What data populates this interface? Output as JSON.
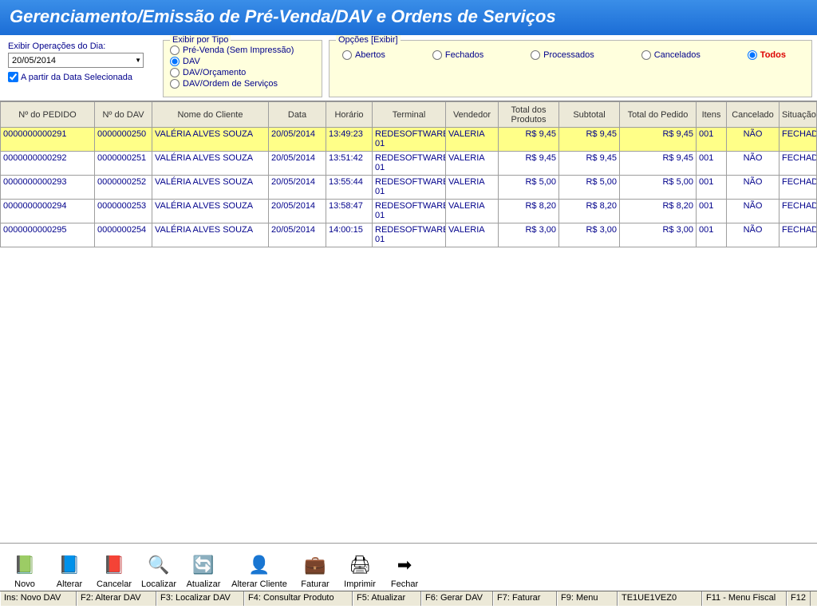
{
  "title": "Gerenciamento/Emissão de Pré-Venda/DAV e Ordens de Serviços",
  "date": {
    "label": "Exibir Operações do Dia:",
    "value": "20/05/2014",
    "fromLabel": "A partir da Data Selecionada",
    "fromChecked": true
  },
  "tipo": {
    "legend": "Exibir por Tipo",
    "opts": [
      "Pré-Venda (Sem Impressão)",
      "DAV",
      "DAV/Orçamento",
      "DAV/Ordem de Serviços"
    ],
    "selected": 1
  },
  "opcoes": {
    "legend": "Opções [Exibir]",
    "opts": [
      "Abertos",
      "Fechados",
      "Processados",
      "Cancelados",
      "Todos"
    ],
    "selected": 4
  },
  "columns": [
    "Nº do PEDIDO",
    "Nº do DAV",
    "Nome do Cliente",
    "Data",
    "Horário",
    "Terminal",
    "Vendedor",
    "Total dos Produtos",
    "Subtotal",
    "Total do Pedido",
    "Itens",
    "Cancelado",
    "Situação"
  ],
  "rows": [
    {
      "pedido": "0000000000291",
      "dav": "0000000250",
      "cliente": "VALÉRIA ALVES SOUZA",
      "data": "20/05/2014",
      "hora": "13:49:23",
      "term": "REDESOFTWARE 01",
      "vend": "VALERIA",
      "tprod": "R$ 9,45",
      "subt": "R$ 9,45",
      "tped": "R$ 9,45",
      "itens": "001",
      "canc": "NÃO",
      "sit": "FECHADO"
    },
    {
      "pedido": "0000000000292",
      "dav": "0000000251",
      "cliente": "VALÉRIA ALVES SOUZA",
      "data": "20/05/2014",
      "hora": "13:51:42",
      "term": "REDESOFTWARE 01",
      "vend": "VALERIA",
      "tprod": "R$ 9,45",
      "subt": "R$ 9,45",
      "tped": "R$ 9,45",
      "itens": "001",
      "canc": "NÃO",
      "sit": "FECHADO"
    },
    {
      "pedido": "0000000000293",
      "dav": "0000000252",
      "cliente": "VALÉRIA ALVES SOUZA",
      "data": "20/05/2014",
      "hora": "13:55:44",
      "term": "REDESOFTWARE 01",
      "vend": "VALERIA",
      "tprod": "R$ 5,00",
      "subt": "R$ 5,00",
      "tped": "R$ 5,00",
      "itens": "001",
      "canc": "NÃO",
      "sit": "FECHADO"
    },
    {
      "pedido": "0000000000294",
      "dav": "0000000253",
      "cliente": "VALÉRIA ALVES SOUZA",
      "data": "20/05/2014",
      "hora": "13:58:47",
      "term": "REDESOFTWARE 01",
      "vend": "VALERIA",
      "tprod": "R$ 8,20",
      "subt": "R$ 8,20",
      "tped": "R$ 8,20",
      "itens": "001",
      "canc": "NÃO",
      "sit": "FECHADO"
    },
    {
      "pedido": "0000000000295",
      "dav": "0000000254",
      "cliente": "VALÉRIA ALVES SOUZA",
      "data": "20/05/2014",
      "hora": "14:00:15",
      "term": "REDESOFTWARE 01",
      "vend": "VALERIA",
      "tprod": "R$ 3,00",
      "subt": "R$ 3,00",
      "tped": "R$ 3,00",
      "itens": "001",
      "canc": "NÃO",
      "sit": "FECHADO"
    }
  ],
  "toolbar": [
    {
      "name": "novo",
      "label": "Novo",
      "icon": "📗",
      "w": 0
    },
    {
      "name": "alterar",
      "label": "Alterar",
      "icon": "📘",
      "w": 0
    },
    {
      "name": "cancelar",
      "label": "Cancelar",
      "icon": "📕",
      "w": 0
    },
    {
      "name": "localizar",
      "label": "Localizar",
      "icon": "🔍",
      "w": 0
    },
    {
      "name": "atualizar",
      "label": "Atualizar",
      "icon": "🔄",
      "w": 0
    },
    {
      "name": "alterar-cliente",
      "label": "Alterar Cliente",
      "icon": "👤",
      "w": 1
    },
    {
      "name": "faturar",
      "label": "Faturar",
      "icon": "💼",
      "w": 0
    },
    {
      "name": "imprimir",
      "label": "Imprimir",
      "icon": "🖨",
      "w": 0
    },
    {
      "name": "fechar",
      "label": "Fechar",
      "icon": "➡",
      "w": 0
    }
  ],
  "status": [
    "Ins: Novo DAV",
    "F2: Alterar DAV",
    "F3: Localizar DAV",
    "F4: Consultar Produto",
    "F5: Atualizar",
    "F6: Gerar DAV",
    "F7: Faturar",
    "F9: Menu",
    "TE1UE1VEZ0",
    "F11 - Menu Fiscal",
    "F12"
  ]
}
